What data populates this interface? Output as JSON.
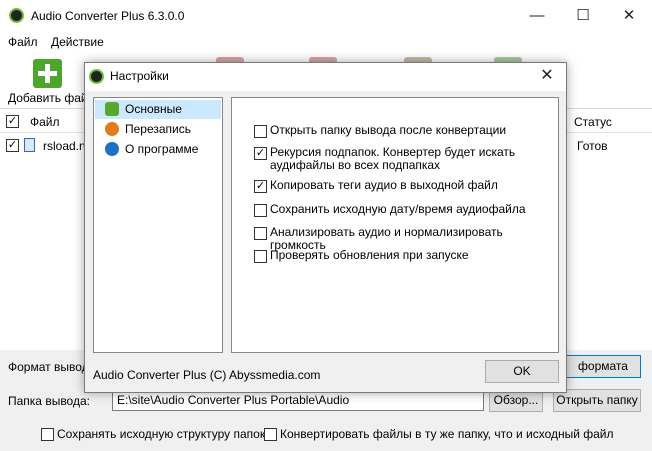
{
  "window": {
    "title": "Audio Converter Plus 6.3.0.0",
    "minimize_glyph": "—",
    "maximize_glyph": "☐",
    "close_glyph": "✕"
  },
  "menu": [
    "Файл",
    "Действие"
  ],
  "toolbar": {
    "add_label": "Добавить файл"
  },
  "filelist": {
    "columns": {
      "file": "Файл",
      "status": "Статус"
    },
    "rows": [
      {
        "name": "rsload.ne",
        "status": "Готов",
        "checked": true
      }
    ]
  },
  "bottom": {
    "format_label": "Формат вывод",
    "format_button": "формата",
    "folder_label": "Папка вывода:",
    "folder_path": "E:\\site\\Audio Converter Plus Portable\\Audio",
    "browse_button": "Обзор...",
    "open_folder_button": "Открыть папку",
    "keep_structure": "Сохранять исходную структуру папок",
    "same_folder": "Конвертировать файлы в ту же папку, что и исходный файл"
  },
  "dialog": {
    "title": "Настройки",
    "close_glyph": "✕",
    "tree": [
      {
        "label": "Основные",
        "selected": true,
        "icon": "general-settings-icon",
        "color": "#5aa72e"
      },
      {
        "label": "Перезапись",
        "selected": false,
        "icon": "overwrite-icon",
        "color": "#e07b1e"
      },
      {
        "label": "О программе",
        "selected": false,
        "icon": "info-icon",
        "color": "#1f6fc5"
      }
    ],
    "options": [
      {
        "label": "Открыть папку вывода после конвертации",
        "checked": false
      },
      {
        "label": "Рекурсия подпапок. Конвертер будет искать аудифайлы во всех подпапках",
        "checked": true
      },
      {
        "label": "Копировать теги аудио в выходной файл",
        "checked": true
      },
      {
        "label": "Сохранить исходную дату/время аудиофайла",
        "checked": false
      },
      {
        "label": "Анализировать аудио и нормализировать громкость",
        "checked": false
      },
      {
        "label": "Проверять обновления при запуске",
        "checked": false
      }
    ],
    "footer": "Audio Converter Plus (C) Abyssmedia.com",
    "ok_button": "OK"
  },
  "colors": {
    "accent": "#0078d7",
    "tree_selection": "#cce8ff",
    "add_green": "#4ca62c"
  }
}
